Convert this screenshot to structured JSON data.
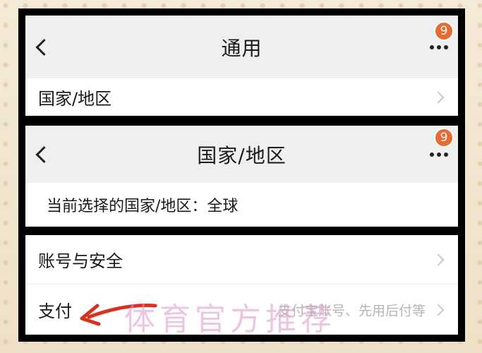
{
  "panel1": {
    "title": "通用",
    "badge": "9",
    "row_label": "国家/地区"
  },
  "panel2": {
    "title": "国家/地区",
    "badge": "9",
    "current_region": "当前选择的国家/地区：全球"
  },
  "panel3": {
    "rows": [
      {
        "label": "账号与安全",
        "value": ""
      },
      {
        "label": "支付",
        "value": "支付宝账号、先用后付等"
      }
    ]
  },
  "watermark": "体育官方推荐",
  "colors": {
    "badge": "#e86a33",
    "annotation_arrow": "#d8321e",
    "nav_background": "#efefef"
  },
  "icons": [
    "back-icon",
    "more-icon",
    "chevron-right-icon",
    "red-arrow-annotation"
  ]
}
